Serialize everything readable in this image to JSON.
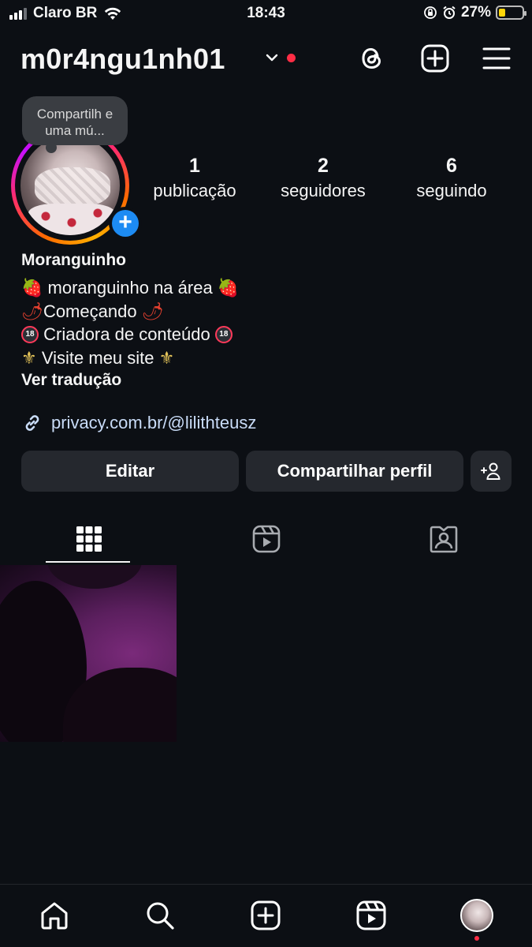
{
  "status_bar": {
    "carrier": "Claro BR",
    "time": "18:43",
    "battery_percent": "27%",
    "battery_level": 0.27,
    "icons": [
      "signal-icon",
      "wifi-icon",
      "orientation-lock-icon",
      "alarm-icon",
      "battery-icon"
    ]
  },
  "header": {
    "username": "m0r4ngu1nh01",
    "icons": [
      "chevron-down-icon",
      "threads-icon",
      "create-post-icon",
      "menu-icon"
    ]
  },
  "profile": {
    "note": "Compartilh e uma mú...",
    "stats": [
      {
        "value": "1",
        "label": "publicação"
      },
      {
        "value": "2",
        "label": "seguidores"
      },
      {
        "value": "6",
        "label": "seguindo"
      }
    ],
    "name": "Moranguinho",
    "bio_lines": [
      {
        "text": "moranguinho na área",
        "emoji": "strawberry"
      },
      {
        "text": "Começando",
        "emoji": "hot-pepper"
      },
      {
        "text": "Criadora de conteúdo",
        "emoji": "no-under-18"
      },
      {
        "text": "Visite meu site",
        "emoji": "fleur-de-lis"
      }
    ],
    "translate_label": "Ver tradução",
    "link": "privacy.com.br/@lilithteusz"
  },
  "actions": {
    "edit_label": "Editar",
    "share_label": "Compartilhar perfil",
    "add_person_icon": "add-person-icon"
  },
  "tabs": [
    {
      "name": "grid",
      "icon": "grid-icon",
      "active": true
    },
    {
      "name": "reels",
      "icon": "reels-icon",
      "active": false
    },
    {
      "name": "tagged",
      "icon": "tagged-icon",
      "active": false
    }
  ],
  "bottom_nav": [
    "home-icon",
    "search-icon",
    "create-icon",
    "reels-icon",
    "profile-avatar"
  ],
  "colors": {
    "background": "#0c0f14",
    "button": "#25282e",
    "accent_blue": "#1d8bf3",
    "notification_red": "#ff2d45",
    "link": "#c9dcf8"
  }
}
